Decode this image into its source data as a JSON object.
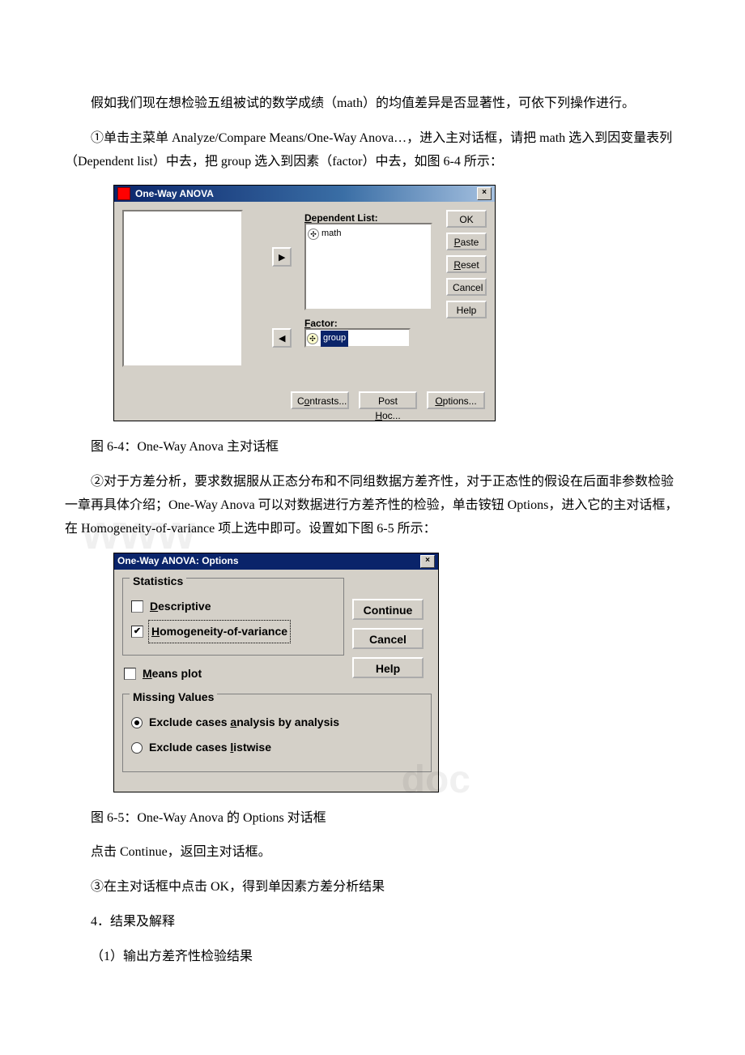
{
  "paragraphs": {
    "p1": "假如我们现在想检验五组被试的数学成绩（math）的均值差异是否显著性，可依下列操作进行。",
    "p2": "①单击主菜单 Analyze/Compare Means/One-Way Anova…，进入主对话框，请把 math 选入到因变量表列（Dependent list）中去，把 group 选入到因素（factor）中去，如图 6-4 所示：",
    "cap1": "图 6-4：One-Way Anova 主对话框",
    "p3": "②对于方差分析，要求数据服从正态分布和不同组数据方差齐性，对于正态性的假设在后面非参数检验一章再具体介绍；One-Way Anova 可以对数据进行方差齐性的检验，单击铵钮 Options，进入它的主对话框，在 Homogeneity-of-variance 项上选中即可。设置如下图 6-5 所示：",
    "cap2": "图 6-5：One-Way Anova 的 Options 对话框",
    "p4": "点击 Continue，返回主对话框。",
    "p5": "③在主对话框中点击 OK，得到单因素方差分析结果",
    "p6": "4．结果及解释",
    "p7": "（1）输出方差齐性检验结果"
  },
  "dialog1": {
    "title": "One-Way ANOVA",
    "dependent_label": "Dependent List:",
    "dependent_item": "math",
    "factor_label": "Factor:",
    "factor_item": "group",
    "buttons": {
      "ok": "OK",
      "paste": "Paste",
      "reset": "Reset",
      "cancel": "Cancel",
      "help": "Help",
      "contrasts": "Contrasts...",
      "posthoc": "Post Hoc...",
      "options": "Options..."
    }
  },
  "dialog2": {
    "title": "One-Way ANOVA: Options",
    "group_statistics": "Statistics",
    "descriptive": "Descriptive",
    "homogeneity": "Homogeneity-of-variance",
    "means_plot": "Means plot",
    "group_missing": "Missing Values",
    "exclude_analysis": "Exclude cases analysis by analysis",
    "exclude_listwise": "Exclude cases listwise",
    "buttons": {
      "continue": "Continue",
      "cancel": "Cancel",
      "help": "Help"
    },
    "state": {
      "descriptive_checked": false,
      "homogeneity_checked": true,
      "means_plot_checked": false,
      "missing_selected": "analysis"
    }
  }
}
